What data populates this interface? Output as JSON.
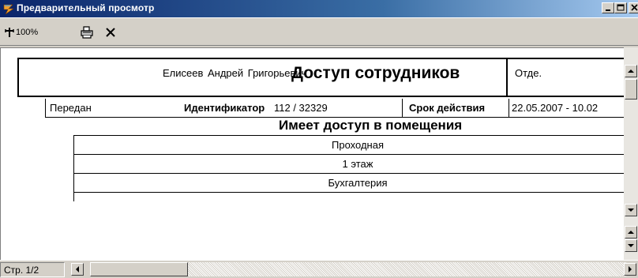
{
  "window": {
    "title": "Предварительный просмотр"
  },
  "toolbar": {
    "zoom_label": "100%"
  },
  "report": {
    "title": "Доступ сотрудников",
    "employee_name": "Елисеев  Андрей  Григорьевич",
    "department_label": "Отде.",
    "status": "Передан",
    "id_label": "Идентификатор",
    "id_value": "112 / 32329",
    "validity_label": "Срок действия",
    "validity_value": "22.05.2007 - 10.02",
    "access_title": "Имеет доступ в помещения",
    "rooms": [
      "Проходная",
      "1 этаж",
      "Бухгалтерия"
    ]
  },
  "status_bar": {
    "page": "Стр. 1/2"
  },
  "colors": {
    "title_bar_start": "#0a246a",
    "title_bar_end": "#a6caf0",
    "window_face": "#d4d0c8",
    "page_bg": "#ffffff"
  },
  "icons": [
    "app-icon",
    "zoom-icon",
    "print-icon",
    "close-preview-icon",
    "minimize-icon",
    "maximize-icon",
    "close-icon"
  ]
}
